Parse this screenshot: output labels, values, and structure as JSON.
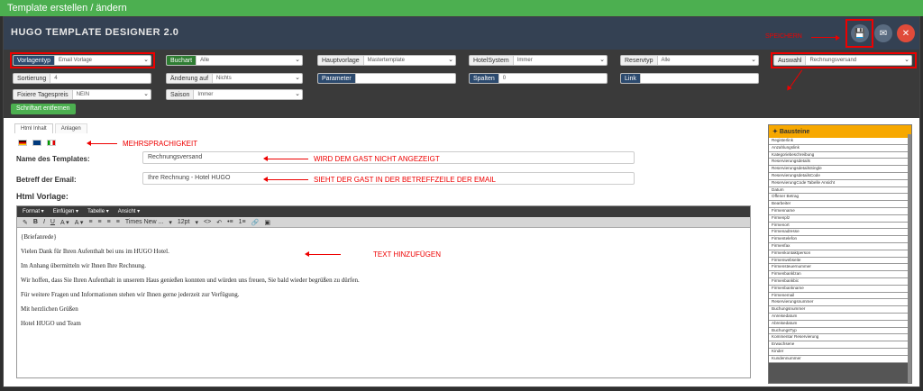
{
  "window": {
    "title": "Template erstellen / ändern"
  },
  "header": {
    "app_title": "HUGO TEMPLATE DESIGNER 2.0"
  },
  "filters": {
    "vorlagentyp": {
      "label": "Vorlagentyp",
      "value": "Email Vorlage"
    },
    "buchart": {
      "label": "Buchart",
      "value": "Alle"
    },
    "hauptvorlage": {
      "label": "Hauptvorlage",
      "value": "Mastertemplate"
    },
    "hotelsystem": {
      "label": "HotelSystem",
      "value": "Immer"
    },
    "reservtyp": {
      "label": "Reservtyp",
      "value": "Alle"
    },
    "auswahl": {
      "label": "Auswahl",
      "value": "Rechnungsversand"
    },
    "sortierung": {
      "label": "Sortierung",
      "value": "4"
    },
    "aenderung": {
      "label": "Änderung auf",
      "value": "Nichts"
    },
    "parameter": {
      "label": "Parameter",
      "value": ""
    },
    "spalten": {
      "label": "Spalten",
      "value": "0"
    },
    "link": {
      "label": "Link",
      "value": ""
    },
    "fixiere": {
      "label": "Fixiere Tagespreis",
      "value": "NEIN"
    },
    "saison": {
      "label": "Saison",
      "value": "Immer"
    },
    "schriftart_button": "Schriftart entfernen"
  },
  "tabs": [
    "Html Inhalt",
    "Anlagen"
  ],
  "form": {
    "name_label": "Name des Templates:",
    "name_value": "Rechnungsversand",
    "betreff_label": "Betreff der Email:",
    "betreff_value": "Ihre Rechnung - Hotel HUGO",
    "html_label": "Html Vorlage:"
  },
  "editor": {
    "menus": [
      "Format ▾",
      "Einfügen ▾",
      "Tabelle ▾",
      "Ansicht ▾"
    ],
    "font": "Times New ...",
    "size": "12pt",
    "paragraphs": [
      "{Briefanrede}",
      "Vielen Dank für Ihren Aufenthalt bei uns im HUGO Hotel.",
      "Im Anhang übermitteln wir Ihnen Ihre Rechnung.",
      "Wir hoffen, dass Sie Ihren Aufenthalt in unserem Haus genießen konnten und würden uns freuen, Sie bald wieder begrüßen zu dürfen.",
      "Für weitere Fragen und Informationen stehen wir Ihnen gerne jederzeit zur Verfügung.",
      "Mit herzlichen Grüßen",
      "Hotel HUGO und Team"
    ]
  },
  "annotations": {
    "speichern": "SPEICHERN",
    "mehrsprachigkeit": "MEHRSPRACHIGKEIT",
    "nicht_angezeigt": "WIRD DEM GAST NICHT ANGEZEIGT",
    "betreffzeile": "SIEHT DER GAST IN DER BETREFFZEILE DER EMAIL",
    "text_hinzufuegen": "TEXT HINZUFÜGEN"
  },
  "bausteine": {
    "title": "Bausteine",
    "items": [
      "Registerlink",
      "Anzahlungslink",
      "Kategoriebeschreibung",
      "Reservierungsdetails",
      "ReservierungsdetailsSingle",
      "ReservierungsdetailsCode",
      "ReservierungCode Tabelle Ansicht",
      "Datum",
      "Offener Betrag",
      "Bearbeiter",
      "Firmenname",
      "Firmenplz",
      "Firmenort",
      "Firmenadresse",
      "Firmentelefon",
      "Firmenfax",
      "Firmenkontaktperson",
      "Firmenwebseite",
      "Firmensteuernummer",
      "Firmenbanklzan",
      "Firmenbankbic",
      "Firmenbankname",
      "Firmenemail",
      "Reservierungsnummer",
      "Buchungsnummer",
      "Anreisedatum",
      "Abreisedatum",
      "BuchungsTyp",
      "Kommentar Reservierung",
      "Erwachsene",
      "Kinder",
      "Kundennummer"
    ]
  },
  "colors": {
    "header": "#344153",
    "accent_green": "#4caf50",
    "annotation_red": "#e00000",
    "bausteine_head": "#f7a800"
  }
}
